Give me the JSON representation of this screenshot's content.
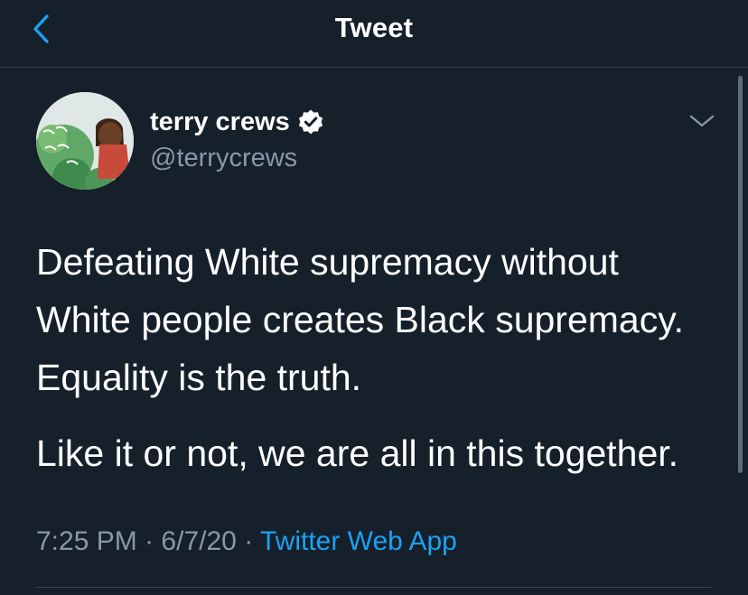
{
  "header": {
    "title": "Tweet",
    "back_icon": "chevron-left-icon",
    "accent_color": "#1da1f2"
  },
  "author": {
    "display_name": "terry crews",
    "handle": "@terrycrews",
    "verified": true,
    "verified_icon": "verified-badge-icon",
    "avatar": "profile-avatar"
  },
  "tweet": {
    "paragraphs": [
      "Defeating White supremacy without White people creates Black supremacy. Equality is the truth.",
      "Like it or not, we are all in this together."
    ],
    "time": "7:25 PM",
    "separator": "·",
    "date": "6/7/20",
    "source": "Twitter Web App",
    "menu_icon": "chevron-down-icon"
  },
  "colors": {
    "background": "#15202b",
    "text": "#ffffff",
    "secondary_text": "#8899a6",
    "divider": "#38444d",
    "link": "#1da1f2"
  }
}
